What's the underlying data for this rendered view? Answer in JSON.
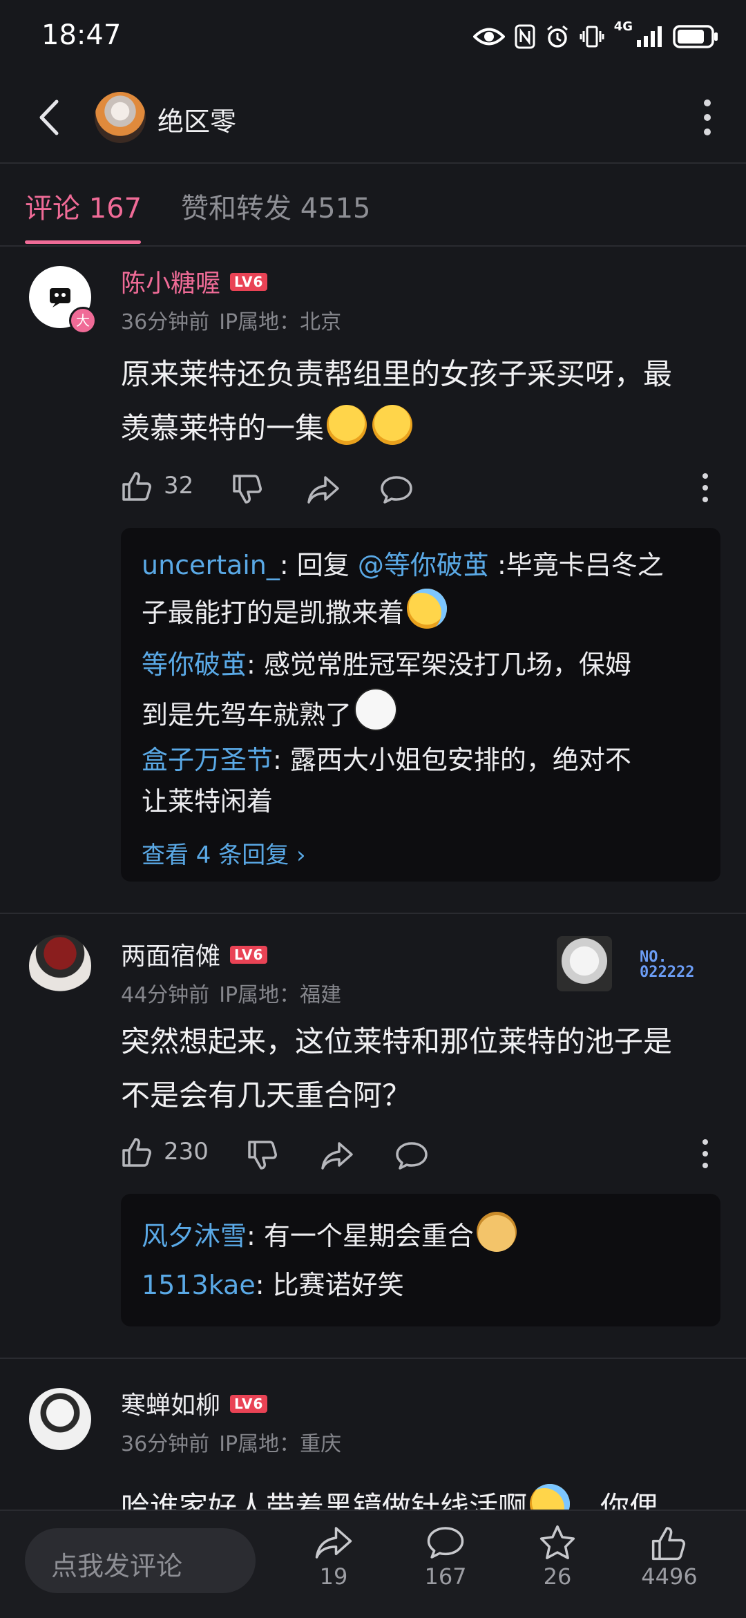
{
  "status": {
    "time": "18:47",
    "network": "4G"
  },
  "header": {
    "title": "绝区零"
  },
  "tabs": {
    "comments": "评论 167",
    "likes_reposts": "赞和转发 4515"
  },
  "comments": [
    {
      "username": "陈小糖喔",
      "level": "LV6",
      "avatar_badge": "大",
      "time": "36分钟前",
      "ip": "IP属地：北京",
      "text_line1": "原来莱特还负责帮组里的女孩子采买呀，最",
      "text_line2": "羡慕莱特的一集",
      "likes": "32",
      "replies": [
        {
          "user": "uncertain_",
          "text_a": ": 回复 ",
          "mention": "@等你破茧",
          "text_b": " :毕竟卡吕冬之",
          "text_c": "子最能打的是凯撒来着"
        },
        {
          "user": "等你破茧",
          "text_a": ": 感觉常胜冠军架没打几场，保姆",
          "text_c": "到是先驾车就熟了"
        },
        {
          "user": "盒子万圣节",
          "text_a": ": 露西大小姐包安排的，绝对不",
          "text_c": "让莱特闲着"
        }
      ],
      "see_more": "查看 4 条回复 ›"
    },
    {
      "username": "两面宿傩",
      "level": "LV6",
      "time": "44分钟前",
      "ip": "IP属地：福建",
      "badge_no_line1": "NO.",
      "badge_no_line2": "022222",
      "text_line1": "突然想起来，这位莱特和那位莱特的池子是",
      "text_line2": "不是会有几天重合阿？",
      "likes": "230",
      "replies": [
        {
          "user": "风夕沐雪",
          "text_a": ": 有一个星期会重合"
        },
        {
          "user": "1513kae",
          "text_a": ": 比赛诺好笑"
        }
      ]
    },
    {
      "username": "寒蝉如柳",
      "level": "LV6",
      "time": "36分钟前",
      "ip": "IP属地：重庆",
      "text_line1": "哈谁家好人带着黑镜做针线活啊",
      "text_tail": "你俚"
    }
  ],
  "bottom": {
    "input_placeholder": "点我发评论",
    "share_count": "19",
    "comment_count": "167",
    "star_count": "26",
    "like_count": "4496"
  },
  "colors": {
    "accent": "#f06b97",
    "link": "#5aa9e6",
    "level_badge": "#e94355",
    "background": "#17181c"
  }
}
